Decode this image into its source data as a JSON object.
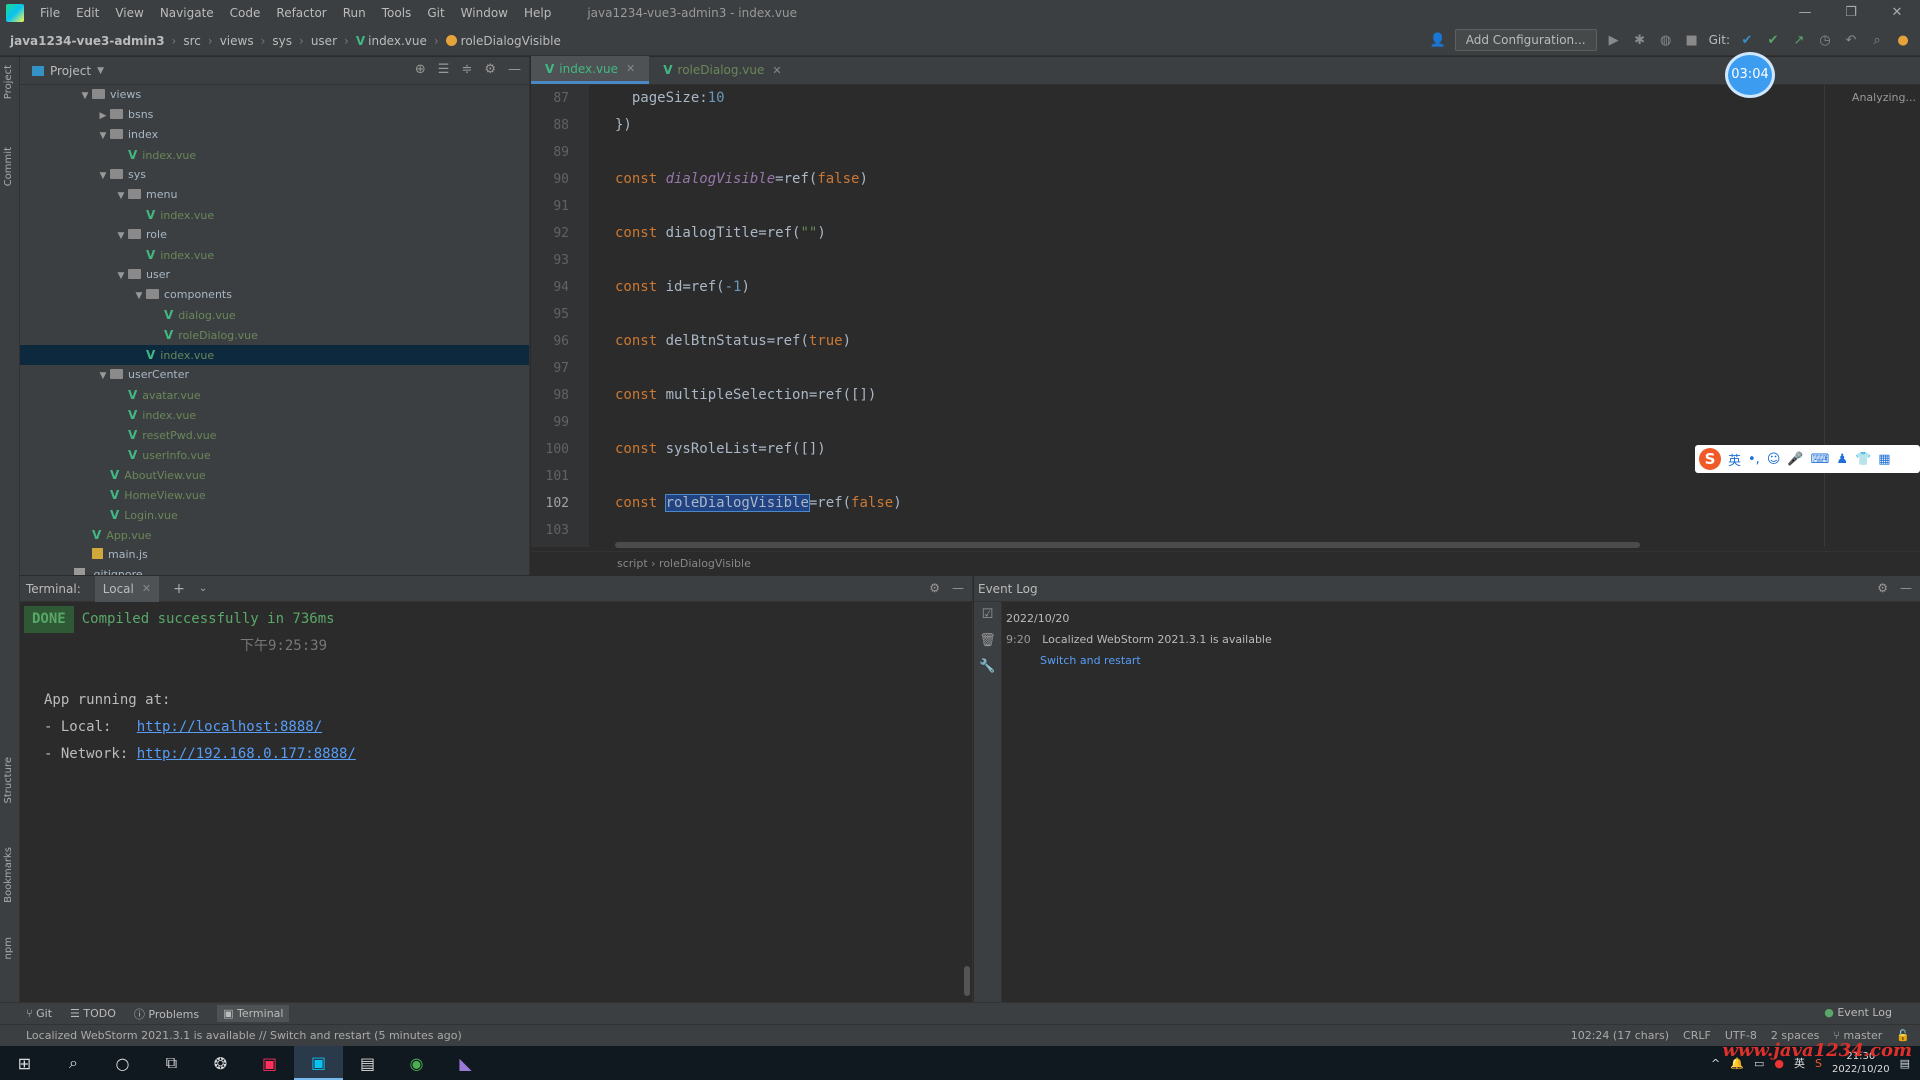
{
  "menubar": {
    "items": [
      "File",
      "Edit",
      "View",
      "Navigate",
      "Code",
      "Refactor",
      "Run",
      "Tools",
      "Git",
      "Window",
      "Help"
    ],
    "title": "java1234-vue3-admin3 - index.vue",
    "controls": [
      "—",
      "❐",
      "✕"
    ]
  },
  "navbar": {
    "crumbs": [
      "java1234-vue3-admin3",
      "src",
      "views",
      "sys",
      "user",
      "index.vue",
      "roleDialogVisible"
    ],
    "add_config": "Add Configuration...",
    "git_label": "Git:"
  },
  "project": {
    "title": "Project",
    "tree": [
      {
        "label": "views",
        "type": "folder",
        "depth": 0,
        "open": true
      },
      {
        "label": "bsns",
        "type": "folder",
        "depth": 1,
        "open": false
      },
      {
        "label": "index",
        "type": "folder",
        "depth": 1,
        "open": true
      },
      {
        "label": "index.vue",
        "type": "vue",
        "depth": 2
      },
      {
        "label": "sys",
        "type": "folder",
        "depth": 1,
        "open": true
      },
      {
        "label": "menu",
        "type": "folder",
        "depth": 2,
        "open": true
      },
      {
        "label": "index.vue",
        "type": "vue",
        "depth": 3
      },
      {
        "label": "role",
        "type": "folder",
        "depth": 2,
        "open": true
      },
      {
        "label": "index.vue",
        "type": "vue",
        "depth": 3
      },
      {
        "label": "user",
        "type": "folder",
        "depth": 2,
        "open": true
      },
      {
        "label": "components",
        "type": "folder",
        "depth": 3,
        "open": true
      },
      {
        "label": "dialog.vue",
        "type": "vue",
        "depth": 4
      },
      {
        "label": "roleDialog.vue",
        "type": "vue",
        "depth": 4
      },
      {
        "label": "index.vue",
        "type": "vue",
        "depth": 3,
        "selected": true
      },
      {
        "label": "userCenter",
        "type": "folder",
        "depth": 1,
        "open": true
      },
      {
        "label": "avatar.vue",
        "type": "vue",
        "depth": 2
      },
      {
        "label": "index.vue",
        "type": "vue",
        "depth": 2
      },
      {
        "label": "resetPwd.vue",
        "type": "vue",
        "depth": 2
      },
      {
        "label": "userInfo.vue",
        "type": "vue",
        "depth": 2
      },
      {
        "label": "AboutView.vue",
        "type": "vue",
        "depth": 1
      },
      {
        "label": "HomeView.vue",
        "type": "vue",
        "depth": 1
      },
      {
        "label": "Login.vue",
        "type": "vue",
        "depth": 1
      },
      {
        "label": "App.vue",
        "type": "vue",
        "depth": 0
      },
      {
        "label": "main.js",
        "type": "js",
        "depth": 0
      },
      {
        "label": ".gitignore",
        "type": "git",
        "depth": -1
      }
    ]
  },
  "editor": {
    "tabs": [
      {
        "label": "index.vue",
        "active": true
      },
      {
        "label": "roleDialog.vue",
        "active": false
      }
    ],
    "analyzing": "Analyzing...",
    "breadcrumb": "script  ›  roleDialogVisible",
    "lines": [
      {
        "n": "87",
        "tokens": [
          {
            "t": "  pageSize:",
            "c": "plain"
          },
          {
            "t": "10",
            "c": "num"
          }
        ]
      },
      {
        "n": "88",
        "tokens": [
          {
            "t": "})",
            "c": "plain"
          }
        ]
      },
      {
        "n": "89",
        "tokens": []
      },
      {
        "n": "90",
        "tokens": [
          {
            "t": "const ",
            "c": "kw"
          },
          {
            "t": "dialogVisible",
            "c": "var"
          },
          {
            "t": "=ref(",
            "c": "plain"
          },
          {
            "t": "false",
            "c": "kw"
          },
          {
            "t": ")",
            "c": "plain"
          }
        ]
      },
      {
        "n": "91",
        "tokens": []
      },
      {
        "n": "92",
        "tokens": [
          {
            "t": "const ",
            "c": "kw"
          },
          {
            "t": "dialogTitle",
            "c": "plain"
          },
          {
            "t": "=ref(",
            "c": "plain"
          },
          {
            "t": "\"\"",
            "c": "str"
          },
          {
            "t": ")",
            "c": "plain"
          }
        ]
      },
      {
        "n": "93",
        "tokens": []
      },
      {
        "n": "94",
        "tokens": [
          {
            "t": "const ",
            "c": "kw"
          },
          {
            "t": "id",
            "c": "plain"
          },
          {
            "t": "=ref(",
            "c": "plain"
          },
          {
            "t": "-1",
            "c": "num"
          },
          {
            "t": ")",
            "c": "plain"
          }
        ]
      },
      {
        "n": "95",
        "tokens": []
      },
      {
        "n": "96",
        "tokens": [
          {
            "t": "const ",
            "c": "kw"
          },
          {
            "t": "delBtnStatus",
            "c": "plain"
          },
          {
            "t": "=ref(",
            "c": "plain"
          },
          {
            "t": "true",
            "c": "kw"
          },
          {
            "t": ")",
            "c": "plain"
          }
        ]
      },
      {
        "n": "97",
        "tokens": []
      },
      {
        "n": "98",
        "tokens": [
          {
            "t": "const ",
            "c": "kw"
          },
          {
            "t": "multipleSelection",
            "c": "plain"
          },
          {
            "t": "=ref([])",
            "c": "plain"
          }
        ]
      },
      {
        "n": "99",
        "tokens": []
      },
      {
        "n": "100",
        "tokens": [
          {
            "t": "const ",
            "c": "kw"
          },
          {
            "t": "sysRoleList",
            "c": "plain"
          },
          {
            "t": "=ref([])",
            "c": "plain"
          }
        ]
      },
      {
        "n": "101",
        "tokens": []
      },
      {
        "n": "102",
        "tokens": [
          {
            "t": "const ",
            "c": "kw"
          },
          {
            "t": "roleDialogVisible",
            "c": "sel"
          },
          {
            "t": "=ref(",
            "c": "plain"
          },
          {
            "t": "false",
            "c": "kw"
          },
          {
            "t": ")",
            "c": "plain"
          }
        ]
      },
      {
        "n": "103",
        "tokens": []
      }
    ]
  },
  "overlay": {
    "timer": "03:04"
  },
  "terminal": {
    "title": "Terminal:",
    "tab": "Local",
    "done_badge": "DONE",
    "compiled": "Compiled successfully in 736ms",
    "time": "下午9:25:39",
    "app_running": "App running at:",
    "local_label": "- Local:   ",
    "local_url": "http://localhost:8888/",
    "network_label": "- Network: ",
    "network_url": "http://192.168.0.177:8888/"
  },
  "eventlog": {
    "title": "Event Log",
    "date": "2022/10/20",
    "time": "9:20",
    "message": "Localized WebStorm 2021.3.1 is available",
    "action": "Switch and restart"
  },
  "bottomtabs": {
    "items": [
      "Git",
      "TODO",
      "Problems",
      "Terminal"
    ],
    "active": "Terminal",
    "event_log": "Event Log"
  },
  "statusbar": {
    "message": "Localized WebStorm 2021.3.1 is available // Switch and restart (5 minutes ago)",
    "position": "102:24 (17 chars)",
    "line_sep": "CRLF",
    "encoding": "UTF-8",
    "indent": "2 spaces",
    "branch": "master"
  },
  "taskbar": {
    "clock_time": "21:30",
    "clock_date": "2022/10/20",
    "ime": "英"
  },
  "watermark": "www.java1234.com"
}
